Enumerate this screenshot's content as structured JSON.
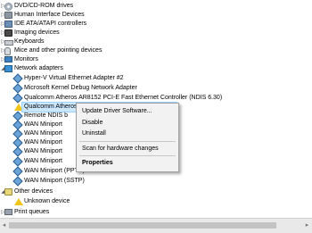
{
  "tree": {
    "items": [
      {
        "label": "DVD/CD-ROM drives"
      },
      {
        "label": "Human Interface Devices"
      },
      {
        "label": "IDE ATA/ATAPI controllers"
      },
      {
        "label": "Imaging devices"
      },
      {
        "label": "Keyboards"
      },
      {
        "label": "Mice and other pointing devices"
      },
      {
        "label": "Monitors"
      },
      {
        "label": "Network adapters"
      },
      {
        "label": "Hyper-V Virtual Ethernet Adapter #2"
      },
      {
        "label": "Microsoft Kernel Debug Network Adapter"
      },
      {
        "label": "Qualcomm Atheros AR8152 PCI-E Fast Ethernet Controller (NDIS 6.30)"
      },
      {
        "label": "Qualcomm Atheros AR9285 Wireless Network Adapter"
      },
      {
        "label": "Remote NDIS b"
      },
      {
        "label": "WAN Miniport"
      },
      {
        "label": "WAN Miniport"
      },
      {
        "label": "WAN Miniport"
      },
      {
        "label": "WAN Miniport"
      },
      {
        "label": "WAN Miniport"
      },
      {
        "label": "WAN Miniport (PPTP)"
      },
      {
        "label": "WAN Miniport (SSTP)"
      },
      {
        "label": "Other devices"
      },
      {
        "label": "Unknown device"
      },
      {
        "label": "Print queues"
      }
    ],
    "expander_collapsed": "▷",
    "expander_expanded": "◢"
  },
  "context_menu": {
    "items": [
      {
        "label": "Update Driver Software..."
      },
      {
        "label": "Disable"
      },
      {
        "label": "Uninstall"
      },
      {
        "label": "Scan for hardware changes"
      },
      {
        "label": "Properties"
      }
    ]
  },
  "scrollbar": {
    "left_arrow": "◂",
    "right_arrow": "▸"
  }
}
